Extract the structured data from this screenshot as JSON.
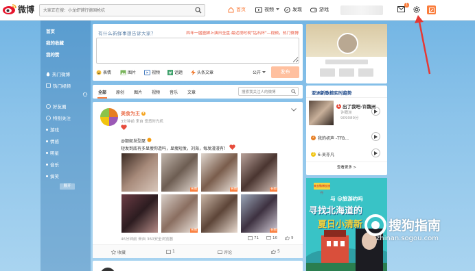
{
  "header": {
    "logo_text": "微博",
    "search_placeholder": "大家正在搜：小龙虾铺行德国枪杭",
    "nav": [
      {
        "label": "首页",
        "active": true
      },
      {
        "label": "视频"
      },
      {
        "label": "发现"
      },
      {
        "label": "游戏"
      }
    ],
    "mail_badge": "1"
  },
  "sidebar": {
    "items": [
      {
        "label": "首页"
      },
      {
        "label": "我的收藏"
      },
      {
        "label": "我的赞"
      },
      {
        "label": "热门微博"
      },
      {
        "label": "热门视频"
      },
      {
        "label": "好友圈"
      },
      {
        "label": "特别关注"
      },
      {
        "label": "游戏"
      },
      {
        "label": "情感"
      },
      {
        "label": "明星"
      },
      {
        "label": "音乐"
      },
      {
        "label": "搞笑"
      }
    ],
    "expand_label": "展开"
  },
  "composer": {
    "prompt": "有什么新鲜事想告诉大家？",
    "hot_topic": "四年一届盛脚上演日全盘.最近视时现\"钻石杯\"—视频，热门微博",
    "tools": [
      "表情",
      "图片",
      "视频",
      "话题",
      "头条文章"
    ],
    "visibility": "公开",
    "send_label": "发布"
  },
  "filter": {
    "tabs": [
      "全部",
      "原创",
      "图片",
      "视频",
      "音乐",
      "文章"
    ],
    "search_placeholder": "搜索我关注人的微博"
  },
  "post": {
    "author": "美食为王",
    "meta": "3分钟前 来自 悠悠时光机",
    "mention": "@靓妮发型屋",
    "text": "短发到底有多显瘦你造吗，显瘦短发，刘海，每发漫漫有！",
    "long_tag": "长图",
    "footer_meta": "46分钟前 来自 360安全浏览器",
    "share_count": "71",
    "comment_count": "16",
    "like_count": "9",
    "actions": {
      "collect": "收藏",
      "share": "1",
      "comment": "评论",
      "like": "5"
    }
  },
  "trending": {
    "title": "亚洲新歌榜实时趋势",
    "top": {
      "rank": "1",
      "title": "出了我吧-许魏洲",
      "artist": "许魏洲",
      "count": "909089分"
    },
    "items": [
      {
        "rank": "2",
        "title": "我的初声 -TFB..."
      },
      {
        "rank": "3",
        "title": "6-吴亦凡"
      }
    ],
    "more": "查看更多 >"
  },
  "ad": {
    "logo": "来去微博去旅行",
    "line1": "与 @旅游约吗",
    "line2": "寻找北海道的",
    "line3": "夏日小清新"
  },
  "watermark": {
    "text": "搜狗指南",
    "url": "zhinan.sogou.com"
  }
}
